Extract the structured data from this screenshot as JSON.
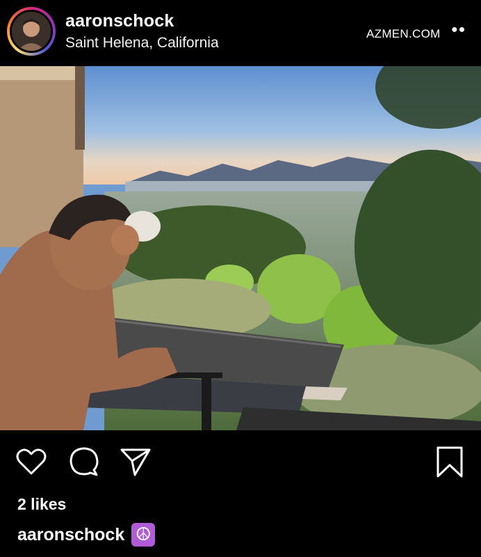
{
  "post": {
    "username": "aaronschock",
    "location": "Saint Helena, California",
    "watermark": "AZMEN.COM",
    "more_icon": "more-dots-icon"
  },
  "actions": {
    "like_icon": "heart-icon",
    "comment_icon": "comment-icon",
    "share_icon": "send-icon",
    "save_icon": "bookmark-icon"
  },
  "engagement": {
    "likes_text": "2 likes"
  },
  "caption": {
    "username": "aaronschock",
    "emoji": "☮"
  },
  "colors": {
    "background": "#000000",
    "text": "#ffffff",
    "emoji_bg": "#b05cd6"
  }
}
